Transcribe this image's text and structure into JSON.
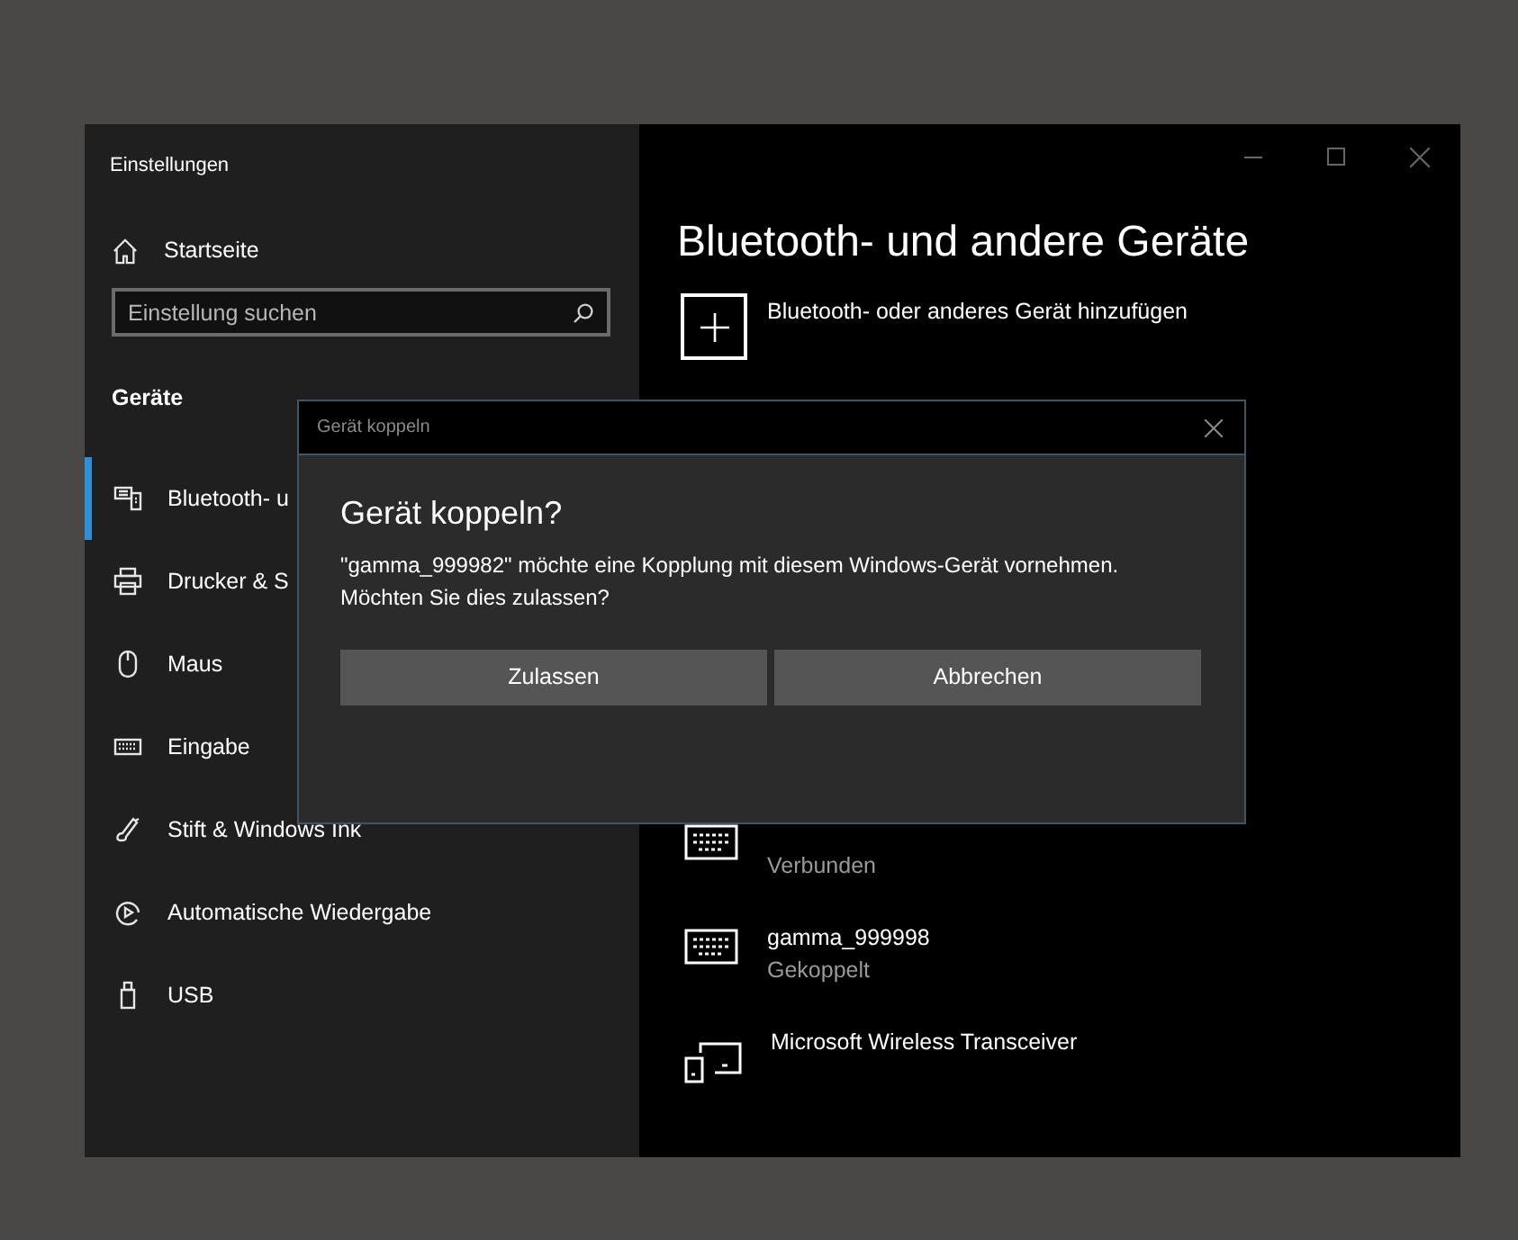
{
  "window": {
    "title": "Einstellungen"
  },
  "sidebar": {
    "home": "Startseite",
    "search": {
      "placeholder": "Einstellung suchen"
    },
    "section": "Geräte",
    "items": [
      {
        "label": "Bluetooth- u",
        "kind": "bluetooth",
        "selected": true
      },
      {
        "label": "Drucker & S",
        "kind": "printer",
        "selected": false
      },
      {
        "label": "Maus",
        "kind": "mouse",
        "selected": false
      },
      {
        "label": "Eingabe",
        "kind": "keyboard",
        "selected": false
      },
      {
        "label": "Stift & Windows Ink",
        "kind": "pen",
        "selected": false
      },
      {
        "label": "Automatische Wiedergabe",
        "kind": "autoplay",
        "selected": false
      },
      {
        "label": "USB",
        "kind": "usb",
        "selected": false
      }
    ]
  },
  "main": {
    "title": "Bluetooth- und andere Geräte",
    "add_device": "Bluetooth- oder anderes Gerät hinzufügen",
    "devices": [
      {
        "kind": "keyboard",
        "status": "Verbunden"
      },
      {
        "kind": "keyboard",
        "name": "gamma_999998",
        "status": "Gekoppelt"
      },
      {
        "kind": "devices",
        "name": "Microsoft Wireless Transceiver"
      }
    ]
  },
  "dialog": {
    "title": "Gerät koppeln",
    "heading": "Gerät koppeln?",
    "message": "\"gamma_999982\" möchte eine Kopplung mit diesem Windows-Gerät vornehmen. Möchten Sie dies zulassen?",
    "buttons": [
      "Zulassen",
      "Abbrechen"
    ]
  }
}
